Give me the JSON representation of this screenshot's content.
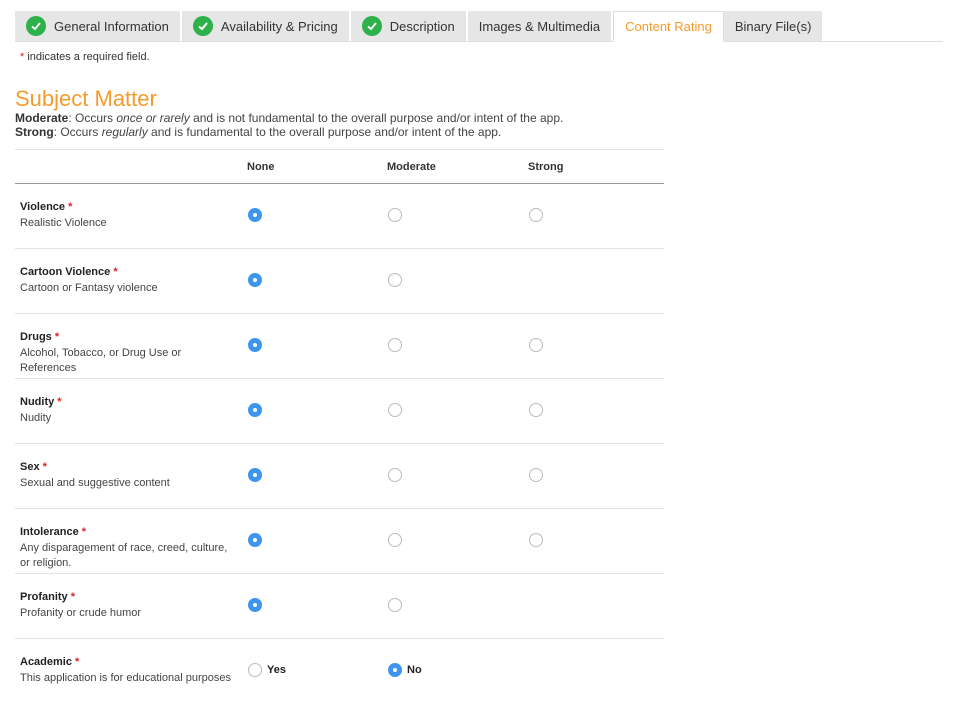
{
  "tabs": [
    {
      "label": "General Information",
      "done": true
    },
    {
      "label": "Availability & Pricing",
      "done": true
    },
    {
      "label": "Description",
      "done": true
    },
    {
      "label": "Images & Multimedia",
      "done": false
    },
    {
      "label": "Content Rating",
      "done": false,
      "active": true
    },
    {
      "label": "Binary File(s)",
      "done": false
    }
  ],
  "required_note": {
    "star": "*",
    "text": " indicates a required field."
  },
  "section_title": "Subject Matter",
  "legend": {
    "moderate": {
      "term": "Moderate",
      "p1": ": Occurs ",
      "em": "once or rarely",
      "p2": " and is not fundamental to the overall purpose and/or intent of the app."
    },
    "strong": {
      "term": "Strong",
      "p1": ": Occurs ",
      "em": "regularly",
      "p2": " and is fundamental to the overall purpose and/or intent of the app."
    }
  },
  "columns": [
    "None",
    "Moderate",
    "Strong"
  ],
  "rows": [
    {
      "name": "Violence",
      "desc": "Realistic Violence",
      "selected": "None",
      "options": [
        "None",
        "Moderate",
        "Strong"
      ]
    },
    {
      "name": "Cartoon Violence",
      "desc": "Cartoon or Fantasy violence",
      "selected": "None",
      "options": [
        "None",
        "Moderate"
      ]
    },
    {
      "name": "Drugs",
      "desc": "Alcohol, Tobacco, or Drug Use or References",
      "selected": "None",
      "options": [
        "None",
        "Moderate",
        "Strong"
      ]
    },
    {
      "name": "Nudity",
      "desc": "Nudity",
      "selected": "None",
      "options": [
        "None",
        "Moderate",
        "Strong"
      ]
    },
    {
      "name": "Sex",
      "desc": "Sexual and suggestive content",
      "selected": "None",
      "options": [
        "None",
        "Moderate",
        "Strong"
      ]
    },
    {
      "name": "Intolerance",
      "desc": "Any disparagement of race, creed, culture, or religion.",
      "selected": "None",
      "options": [
        "None",
        "Moderate",
        "Strong"
      ]
    },
    {
      "name": "Profanity",
      "desc": "Profanity or crude humor",
      "selected": "None",
      "options": [
        "None",
        "Moderate"
      ]
    }
  ],
  "academic": {
    "name": "Academic",
    "desc": "This application is for educational purposes",
    "yes": "Yes",
    "no": "No",
    "selected": "No"
  },
  "colors": {
    "accent": "#f39c2e",
    "check": "#2db14a",
    "radio_selected": "#3d95f0",
    "required": "#e02020"
  }
}
